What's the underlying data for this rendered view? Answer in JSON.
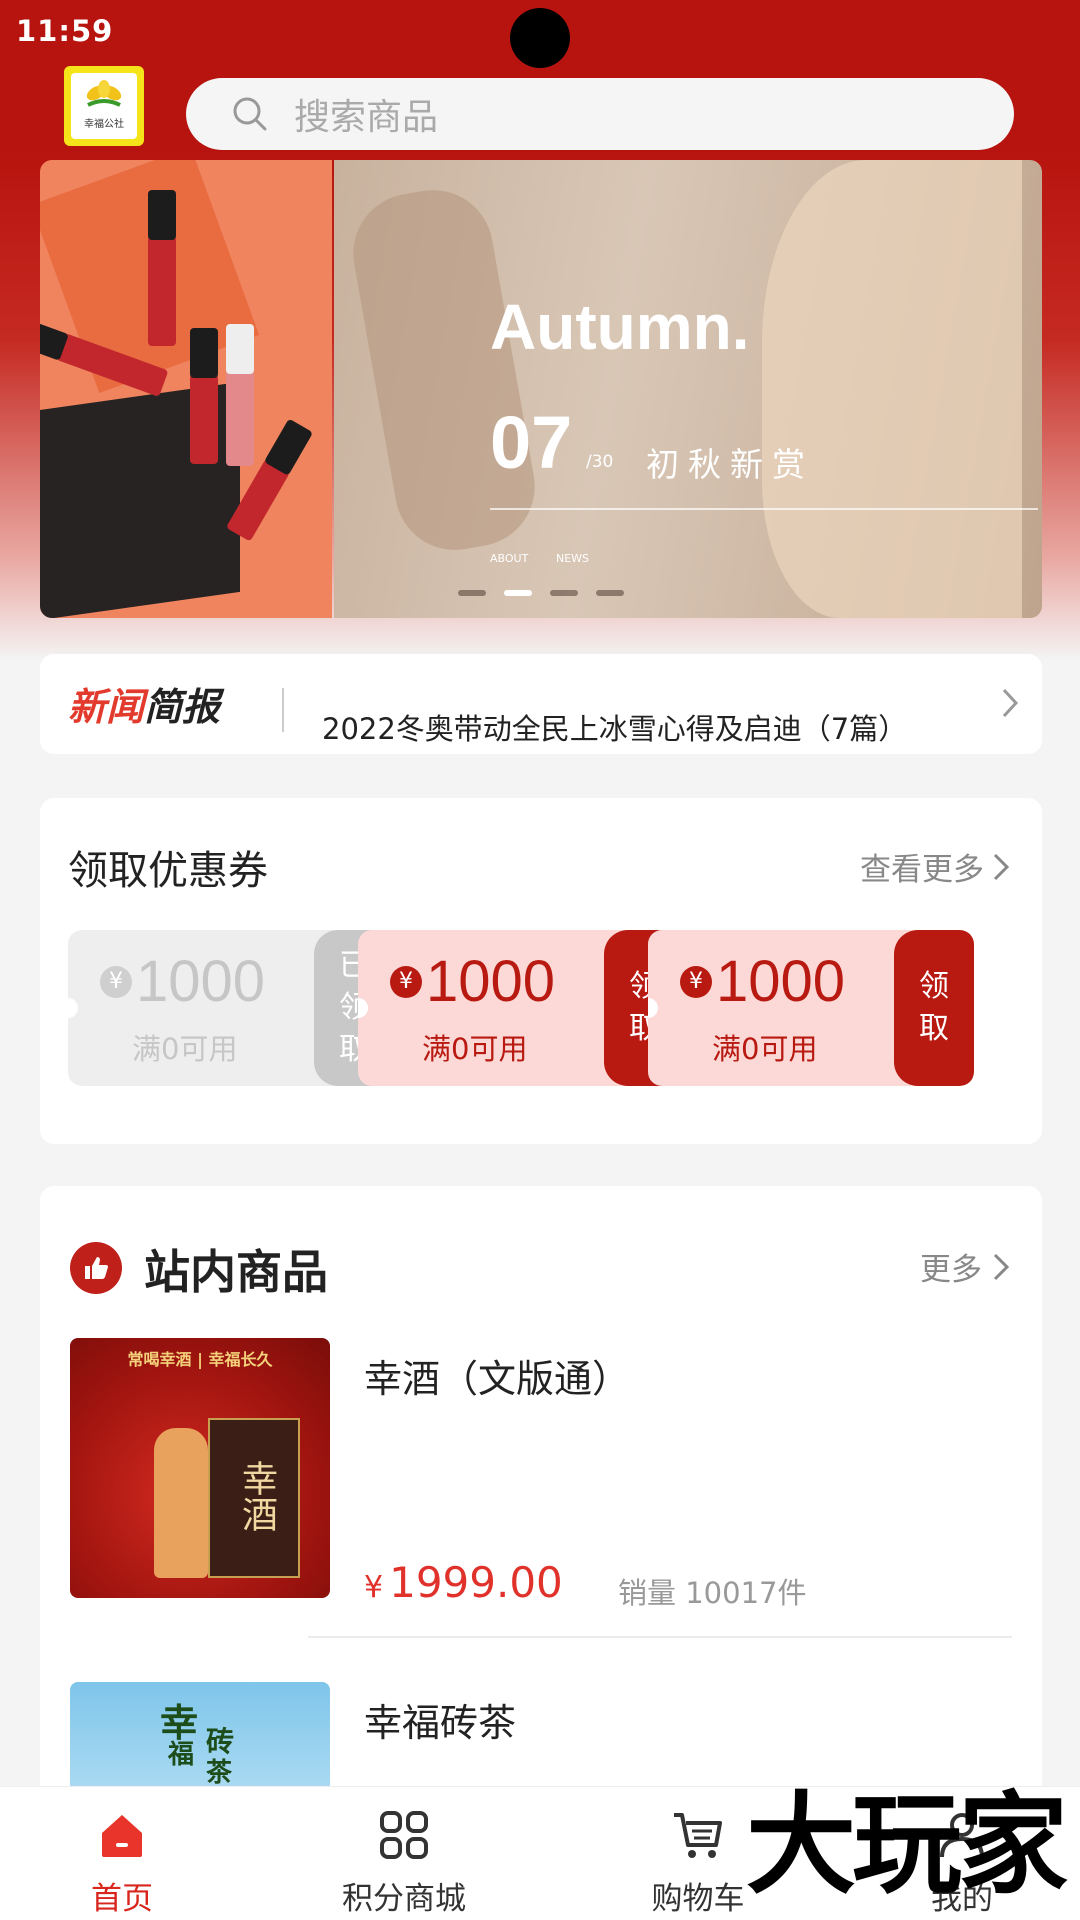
{
  "status_bar": {
    "time": "11:59"
  },
  "header": {
    "logo_text": "幸福公社",
    "search_placeholder": "搜索商品"
  },
  "banner": {
    "title": "Autumn.",
    "number": "07",
    "number_sub": "/30",
    "subtitle": "初秋新赏",
    "link1": "ABOUT",
    "link2": "NEWS",
    "pager_count": 4,
    "active_index": 1
  },
  "news": {
    "logo_part1": "新闻",
    "logo_part2": "简报",
    "headline": "2022冬奥带动全民上冰雪心得及启迪（7篇）"
  },
  "coupons": {
    "title": "领取优惠券",
    "more_label": "查看更多",
    "items": [
      {
        "symbol": "¥",
        "amount": "1000",
        "condition": "满0可用",
        "action": "已领取",
        "state": "used"
      },
      {
        "symbol": "¥",
        "amount": "1000",
        "condition": "满0可用",
        "action": "领取",
        "state": "available"
      },
      {
        "symbol": "¥",
        "amount": "1000",
        "condition": "满0可用",
        "action": "领取",
        "state": "available"
      }
    ]
  },
  "products": {
    "title": "站内商品",
    "more_label": "更多",
    "items": [
      {
        "name": "幸酒（文版通）",
        "currency": "¥",
        "price": "1999.00",
        "sales": "销量 10017件",
        "thumb_top_text": "常喝幸酒 | 幸福长久",
        "thumb_box_text": "幸酒"
      },
      {
        "name": "幸福砖茶",
        "thumb_text1": "幸",
        "thumb_text2": "福",
        "thumb_text3": "砖",
        "thumb_text4": "茶"
      }
    ]
  },
  "tabbar": {
    "items": [
      {
        "label": "首页",
        "icon": "home-icon",
        "active": true
      },
      {
        "label": "积分商城",
        "icon": "grid-icon",
        "active": false
      },
      {
        "label": "购物车",
        "icon": "cart-icon",
        "active": false
      },
      {
        "label": "我的",
        "icon": "user-icon",
        "active": false
      }
    ]
  },
  "watermark": "大玩家",
  "colors": {
    "brand_red": "#b8140f",
    "price_red": "#e0322a",
    "coupon_bg": "#fcd9d6"
  }
}
